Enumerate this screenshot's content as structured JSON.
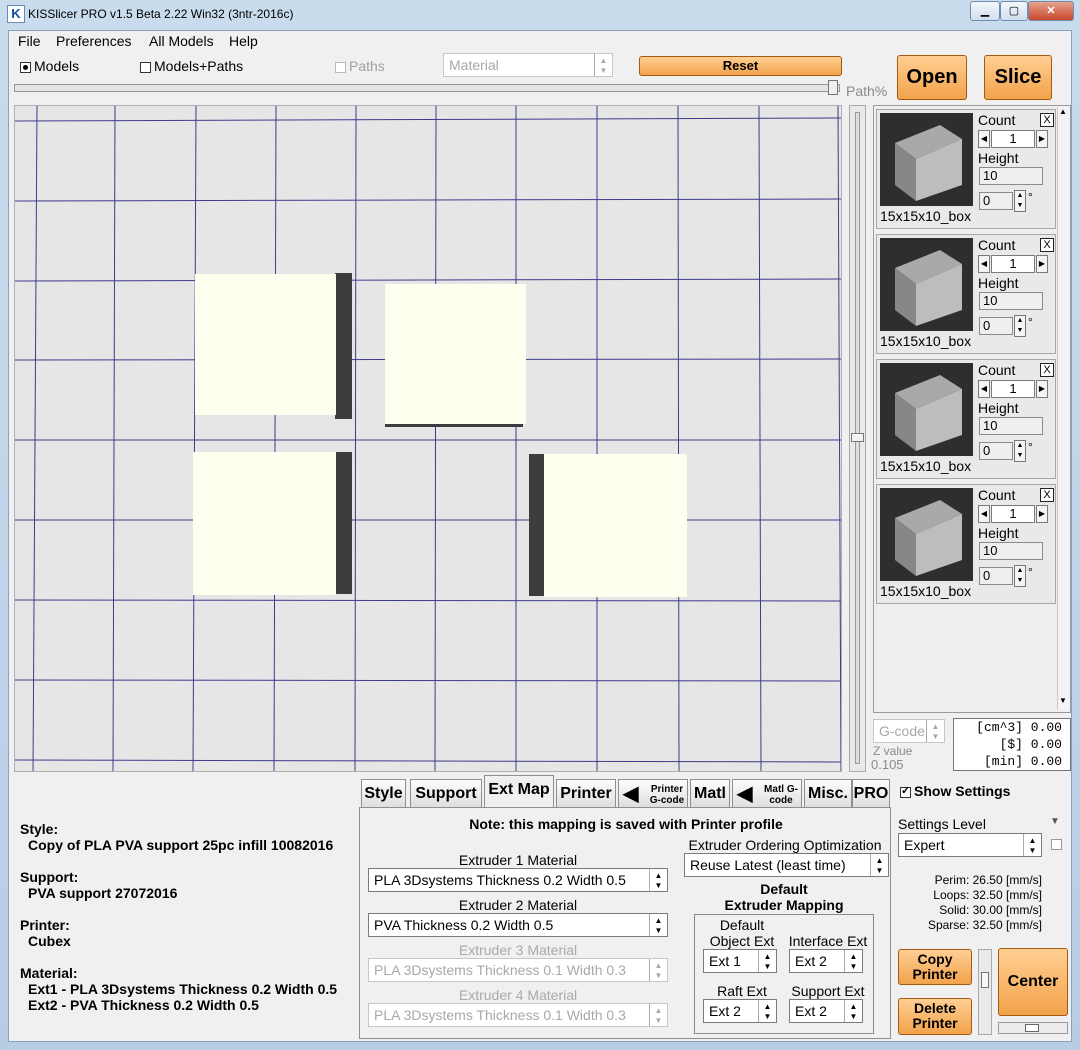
{
  "window": {
    "title": "KISSlicer PRO v1.5 Beta 2.22 Win32 (3ntr-2016c)"
  },
  "menu": [
    "File",
    "Preferences",
    "All Models",
    "Help"
  ],
  "toolbar": {
    "models": "Models",
    "models_paths": "Models+Paths",
    "paths": "Paths",
    "material": "Material",
    "reset": "Reset",
    "open": "Open",
    "slice": "Slice",
    "path_pct": "Path%"
  },
  "models": [
    {
      "count_label": "Count",
      "count": "1",
      "height_label": "Height",
      "height": "10",
      "angle": "0",
      "name": "15x15x10_box"
    },
    {
      "count_label": "Count",
      "count": "1",
      "height_label": "Height",
      "height": "10",
      "angle": "0",
      "name": "15x15x10_box"
    },
    {
      "count_label": "Count",
      "count": "1",
      "height_label": "Height",
      "height": "10",
      "angle": "0",
      "name": "15x15x10_box"
    },
    {
      "count_label": "Count",
      "count": "1",
      "height_label": "Height",
      "height": "10",
      "angle": "0",
      "name": "15x15x10_box"
    }
  ],
  "gcode": {
    "select": "G-code",
    "z_label": "Z value",
    "z_value": "0.105"
  },
  "stats": {
    "vol": "[cm^3] 0.00",
    "cost": "[$] 0.00",
    "time": "[min] 0.00"
  },
  "tabs": [
    "Style",
    "Support",
    "Ext Map",
    "Printer",
    "Printer G-code",
    "Matl",
    "Matl G-code",
    "Misc.",
    "PRO"
  ],
  "extmap": {
    "note": "Note: this mapping is saved with Printer profile",
    "ext1_label": "Extruder 1 Material",
    "ext1_value": "PLA 3Dsystems Thickness 0.2 Width 0.5",
    "ext2_label": "Extruder 2 Material",
    "ext2_value": "PVA Thickness 0.2 Width 0.5",
    "ext3_label": "Extruder 3 Material",
    "ext3_value": "PLA 3Dsystems Thickness 0.1 Width 0.3",
    "ext4_label": "Extruder 4 Material",
    "ext4_value": "PLA 3Dsystems Thickness 0.1 Width 0.3",
    "ordering_label": "Extruder Ordering Optimization",
    "ordering_value": "Reuse Latest (least time)",
    "default_mapping": "Default\nExtruder Mapping",
    "default_obj_label": "Default\nObject Ext",
    "default_obj_value": "Ext 1",
    "interface_label": "Interface Ext",
    "interface_value": "Ext 2",
    "raft_label": "Raft Ext",
    "raft_value": "Ext 2",
    "support_label": "Support Ext",
    "support_value": "Ext 2"
  },
  "info": {
    "style_label": "Style:",
    "style_value": "Copy of PLA PVA support 25pc infill 10082016",
    "support_label": "Support:",
    "support_value": "PVA support 27072016",
    "printer_label": "Printer:",
    "printer_value": "Cubex",
    "material_label": "Material:",
    "material_ext1": "Ext1 - PLA 3Dsystems Thickness 0.2 Width 0.5",
    "material_ext2": "Ext2 - PVA Thickness 0.2 Width 0.5"
  },
  "settings": {
    "show": "Show Settings",
    "level_label": "Settings Level",
    "level_value": "Expert",
    "perim": "Perim: 26.50 [mm/s]",
    "loops": "Loops: 32.50 [mm/s]",
    "solid": "Solid: 30.00 [mm/s]",
    "sparse": "Sparse: 32.50 [mm/s]",
    "copy_printer": "Copy Printer",
    "delete_printer": "Delete Printer",
    "center": "Center"
  }
}
